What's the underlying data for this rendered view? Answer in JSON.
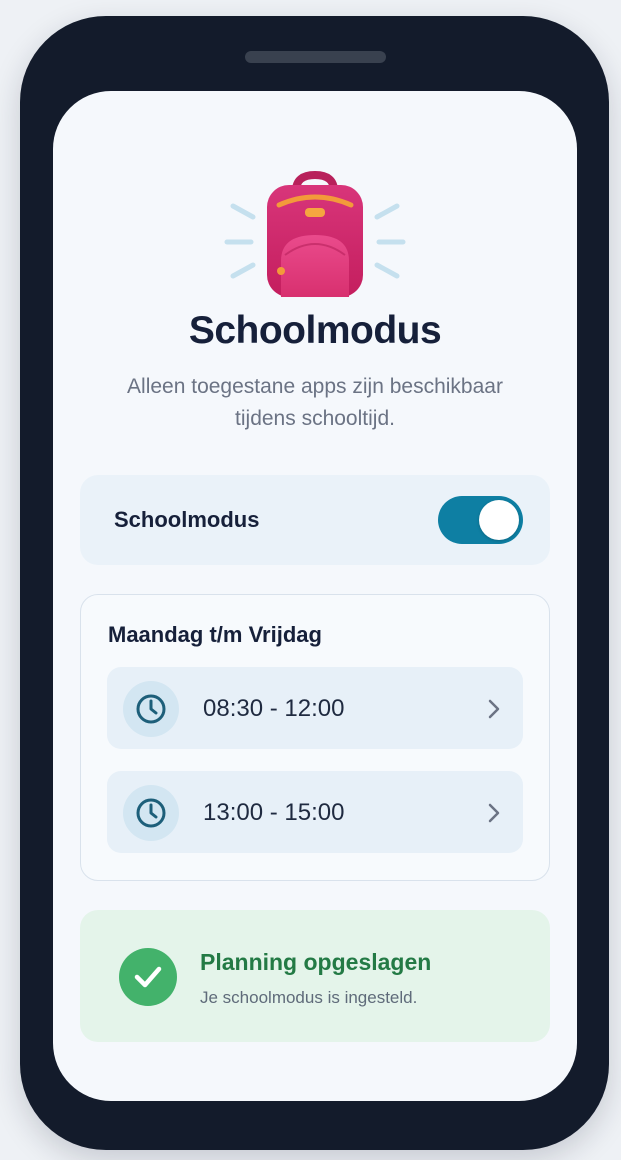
{
  "header": {
    "title": "Schoolmodus",
    "subtitle": "Alleen toegestane apps zijn beschikbaar tijdens schooltijd."
  },
  "toggle": {
    "label": "Schoolmodus",
    "enabled": true
  },
  "schedule": {
    "title": "Maandag t/m Vrijdag",
    "slots": [
      {
        "time": "08:30 - 12:00"
      },
      {
        "time": "13:00 - 15:00"
      }
    ]
  },
  "status": {
    "title": "Planning opgeslagen",
    "text": "Je schoolmodus is ingesteld."
  },
  "colors": {
    "accent": "#0e7fa3",
    "success": "#43b26b",
    "backpack": "#d92f6f"
  }
}
